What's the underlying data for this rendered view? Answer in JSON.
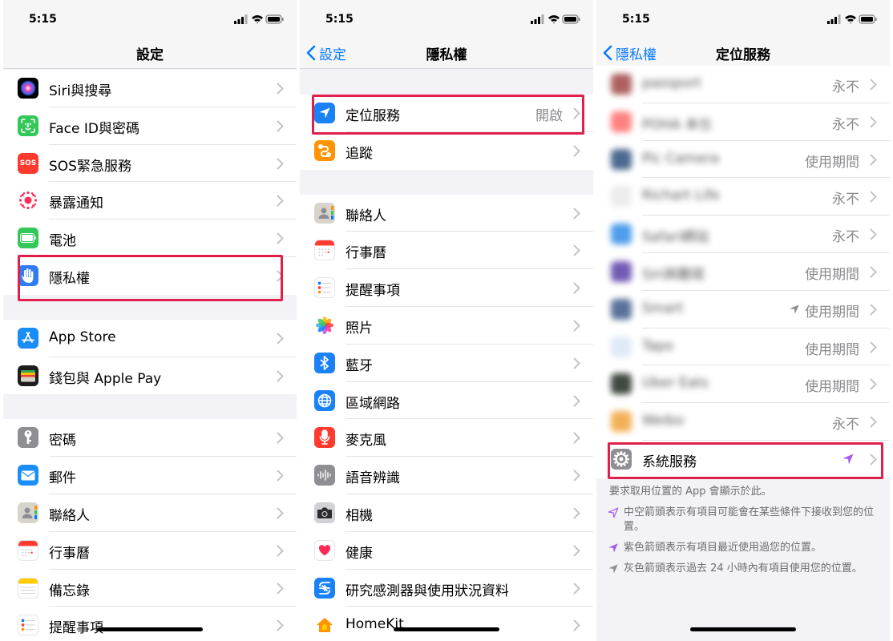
{
  "status": {
    "time": "5:15"
  },
  "panel1": {
    "title": "設定",
    "groups": [
      [
        {
          "label": "Siri與搜尋",
          "icon": "siri-icon"
        },
        {
          "label": "Face ID與密碼",
          "icon": "face-id-icon"
        },
        {
          "label": "SOS緊急服務",
          "icon": "sos-icon",
          "icon_text": "SOS"
        },
        {
          "label": "暴露通知",
          "icon": "exposure-notification-icon"
        },
        {
          "label": "電池",
          "icon": "battery-icon"
        },
        {
          "label": "隱私權",
          "icon": "privacy-hand-icon"
        }
      ],
      [
        {
          "label": "App Store",
          "icon": "app-store-icon"
        },
        {
          "label": "錢包與 Apple Pay",
          "icon": "wallet-icon"
        }
      ],
      [
        {
          "label": "密碼",
          "icon": "key-icon"
        },
        {
          "label": "郵件",
          "icon": "mail-icon"
        },
        {
          "label": "聯絡人",
          "icon": "contacts-icon"
        },
        {
          "label": "行事曆",
          "icon": "calendar-icon"
        },
        {
          "label": "備忘錄",
          "icon": "notes-icon"
        },
        {
          "label": "提醒事項",
          "icon": "reminders-icon"
        }
      ]
    ]
  },
  "panel2": {
    "back_label": "設定",
    "title": "隱私權",
    "groups": [
      [
        {
          "label": "定位服務",
          "value": "開啟",
          "icon": "location-services-icon"
        },
        {
          "label": "追蹤",
          "icon": "tracking-icon"
        }
      ],
      [
        {
          "label": "聯絡人",
          "icon": "contacts-icon"
        },
        {
          "label": "行事曆",
          "icon": "calendar-icon"
        },
        {
          "label": "提醒事項",
          "icon": "reminders-icon"
        },
        {
          "label": "照片",
          "icon": "photos-icon"
        },
        {
          "label": "藍牙",
          "icon": "bluetooth-icon"
        },
        {
          "label": "區域網路",
          "icon": "local-network-icon"
        },
        {
          "label": "麥克風",
          "icon": "microphone-icon"
        },
        {
          "label": "語音辨識",
          "icon": "speech-recognition-icon"
        },
        {
          "label": "相機",
          "icon": "camera-icon"
        },
        {
          "label": "健康",
          "icon": "health-icon"
        },
        {
          "label": "研究感測器與使用狀況資料",
          "icon": "research-sensor-icon"
        },
        {
          "label": "HomeKit",
          "icon": "homekit-icon"
        }
      ]
    ]
  },
  "panel3": {
    "back_label": "隱私權",
    "title": "定位服務",
    "apps": [
      {
        "label": "passport",
        "value": "永不",
        "icon_color": "#a14545"
      },
      {
        "label": "POHA 本仕",
        "value": "永不",
        "icon_color": "#ff6b6b"
      },
      {
        "label": "Pic Camera",
        "value": "使用期間",
        "icon_color": "#2d4f7c"
      },
      {
        "label": "Richart Life",
        "value": "永不",
        "icon_color": "#e9e9e9"
      },
      {
        "label": "Safari網站",
        "value": "永不",
        "icon_color": "#2f8ce8"
      },
      {
        "label": "Siri與聽寫",
        "value": "使用期間",
        "icon_color": "#5a3fa8"
      },
      {
        "label": "Smart",
        "value": "使用期間",
        "icon_color": "#3d5a8a",
        "arrow": true
      },
      {
        "label": "Tapo",
        "value": "使用期間",
        "icon_color": "#d9e6f7"
      },
      {
        "label": "Uber Eats",
        "value": "使用期間",
        "icon_color": "#1f2a1f"
      },
      {
        "label": "Weibo",
        "value": "永不",
        "icon_color": "#f1a33a"
      }
    ],
    "system_services": {
      "label": "系統服務",
      "icon": "gear-icon"
    },
    "footer": "要求取用位置的 App 會顯示於此。",
    "legend": [
      {
        "text": "中空箭頭表示有項目可能會在某些條件下接收到您的位置。",
        "icon": "hollow-arrow-icon"
      },
      {
        "text": "紫色箭頭表示有項目最近使用過您的位置。",
        "icon": "purple-arrow-icon"
      },
      {
        "text": "灰色箭頭表示過去 24 小時內有項目使用您的位置。",
        "icon": "gray-arrow-icon"
      }
    ]
  },
  "colors": {
    "accent": "#0a7aff",
    "highlight": "#e0204c",
    "purple_arrow": "#a35cf0"
  }
}
